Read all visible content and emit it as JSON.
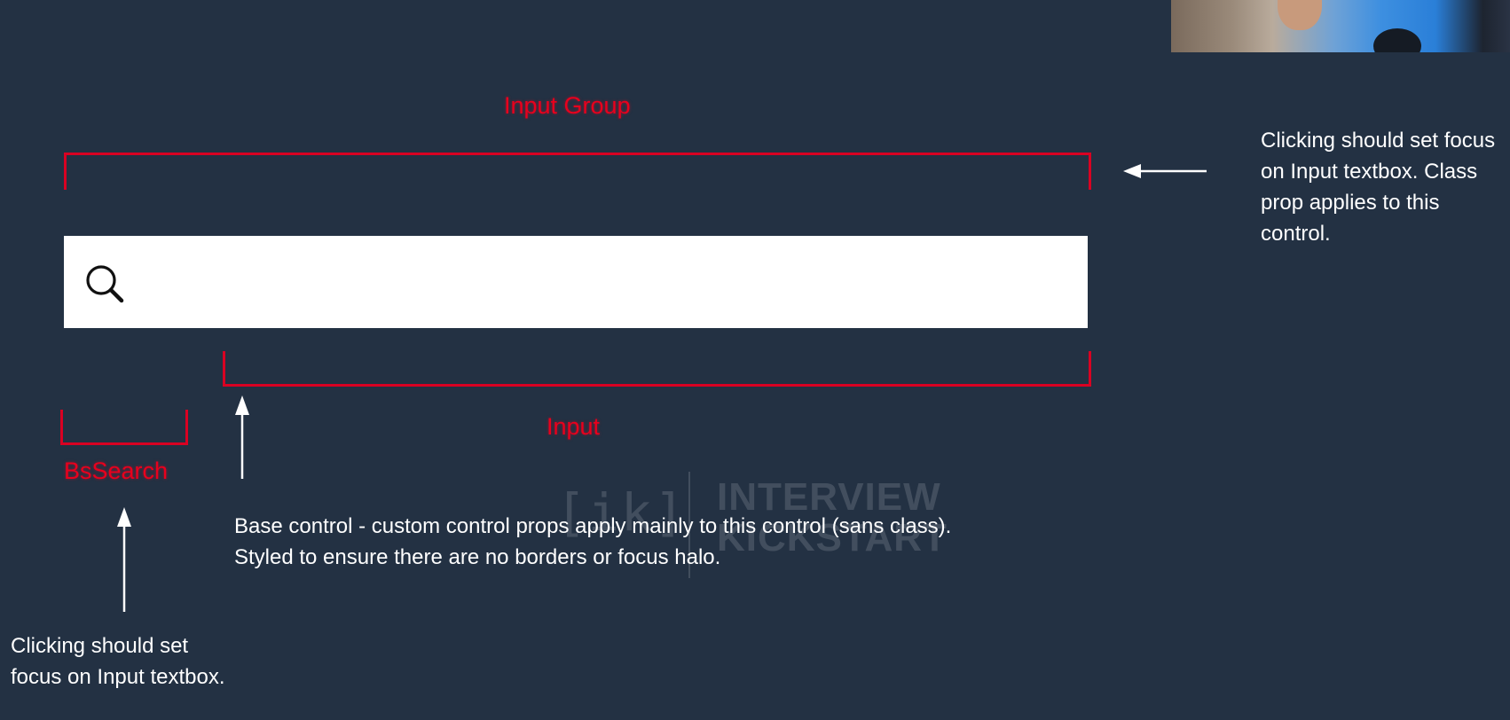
{
  "labels": {
    "input_group": "Input Group",
    "input": "Input",
    "bs_search": "BsSearch"
  },
  "notes": {
    "input_group_note": "Clicking should set focus on Input textbox. Class prop applies to this control.",
    "base_control_line1": "Base control - custom control props apply mainly to this control (sans class).",
    "base_control_line2": "Styled to ensure there are no borders or focus halo.",
    "bs_search_note": "Clicking should set focus on Input textbox."
  },
  "search": {
    "placeholder": "",
    "value": ""
  },
  "watermark": {
    "logo": "[ik]",
    "line1": "INTERVIEW",
    "line2": "KICKSTART"
  },
  "colors": {
    "background": "#233143",
    "annotation_red": "#e8001d",
    "text": "#ffffff"
  },
  "icons": {
    "search": "magnifier-icon"
  }
}
